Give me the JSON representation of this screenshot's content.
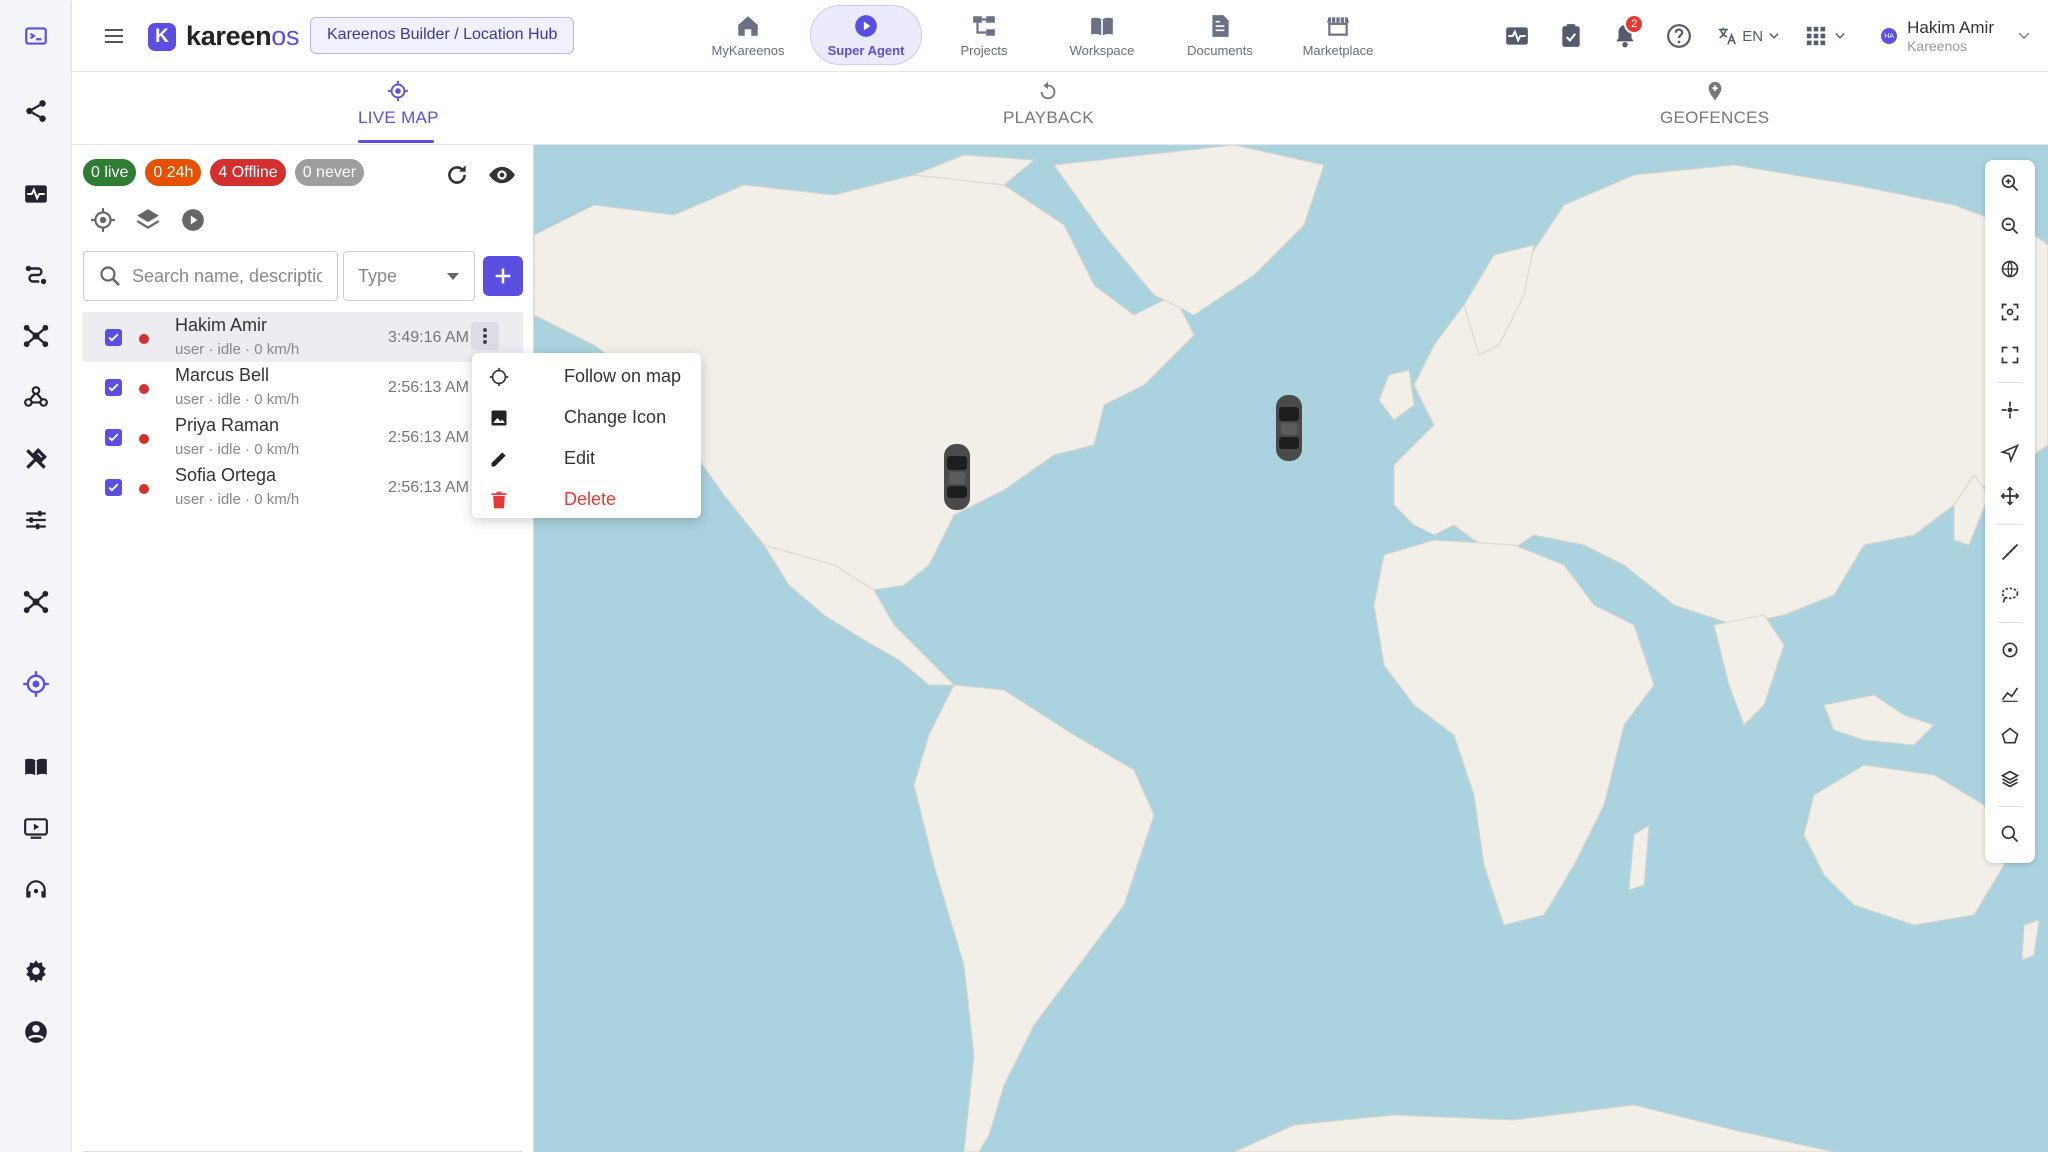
{
  "app": {
    "brand_name": "kareen",
    "brand_suffix": "os",
    "logo_letter": "K",
    "breadcrumb": "Kareenos Builder / Location Hub"
  },
  "nav": [
    {
      "label": "MyKareenos",
      "icon": "home-icon"
    },
    {
      "label": "Super Agent",
      "icon": "play-circle-icon",
      "active": true
    },
    {
      "label": "Projects",
      "icon": "hierarchy-icon"
    },
    {
      "label": "Workspace",
      "icon": "book-open-icon"
    },
    {
      "label": "Documents",
      "icon": "document-icon"
    },
    {
      "label": "Marketplace",
      "icon": "store-icon"
    }
  ],
  "header_right": {
    "notifications_count": "2",
    "language": "EN",
    "user_name": "Hakim Amir",
    "user_org": "Kareenos",
    "avatar_initials": "HA"
  },
  "tabs": [
    {
      "label": "LIVE MAP",
      "active": true
    },
    {
      "label": "PLAYBACK"
    },
    {
      "label": "GEOFENCES"
    }
  ],
  "status_chips": {
    "live": "0 live",
    "h24": "0 24h",
    "offline": "4 Offline",
    "never": "0 never"
  },
  "search": {
    "placeholder": "Search name, description",
    "type_placeholder": "Type"
  },
  "list": [
    {
      "name": "Hakim Amir",
      "sub": "user · idle · 0 km/h",
      "time": "3:49:16 AM",
      "status_color": "#d32f2f",
      "checked": true,
      "selected": true
    },
    {
      "name": "Marcus Bell",
      "sub": "user · idle · 0 km/h",
      "time": "2:56:13 AM",
      "status_color": "#d32f2f",
      "checked": true
    },
    {
      "name": "Priya Raman",
      "sub": "user · idle · 0 km/h",
      "time": "2:56:13 AM",
      "status_color": "#d32f2f",
      "checked": true
    },
    {
      "name": "Sofia Ortega",
      "sub": "user · idle · 0 km/h",
      "time": "2:56:13 AM",
      "status_color": "#d32f2f",
      "checked": true
    }
  ],
  "context_menu": {
    "follow": "Follow on map",
    "change_icon": "Change Icon",
    "edit": "Edit",
    "delete": "Delete"
  },
  "colors": {
    "accent": "#5a4fe0",
    "live": "#2e7d32",
    "h24": "#e65100",
    "offline": "#d32f2f",
    "never": "#9e9e9e",
    "danger": "#e53935",
    "water": "#aad3df",
    "land": "#f2efe9"
  }
}
